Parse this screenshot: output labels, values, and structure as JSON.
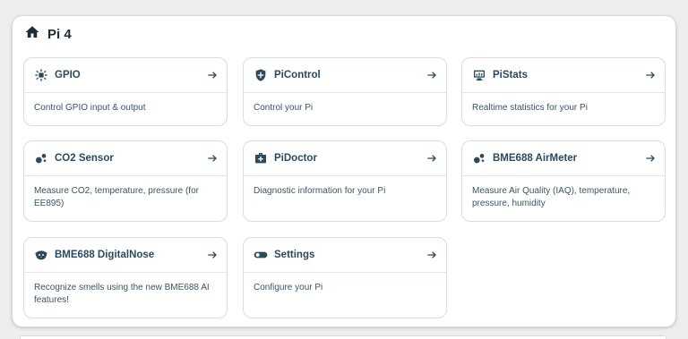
{
  "header": {
    "title": "Pi 4",
    "icon": "home-icon"
  },
  "cards": [
    {
      "title": "GPIO",
      "description": "Control GPIO input & output",
      "icon": "gpio-chip-icon"
    },
    {
      "title": "PiControl",
      "description": "Control your Pi",
      "icon": "shield-icon"
    },
    {
      "title": "PiStats",
      "description": "Realtime statistics for your Pi",
      "icon": "monitor-chart-icon"
    },
    {
      "title": "CO2 Sensor",
      "description": "Measure CO2, temperature, pressure (for EE895)",
      "icon": "bubbles-icon"
    },
    {
      "title": "PiDoctor",
      "description": "Diagnostic information for your Pi",
      "icon": "medical-bag-icon"
    },
    {
      "title": "BME688 AirMeter",
      "description": "Measure Air Quality (IAQ), temperature, pressure, humidity",
      "icon": "bubbles-icon"
    },
    {
      "title": "BME688 DigitalNose",
      "description": "Recognize smells using the new BME688 AI features!",
      "icon": "dog-nose-icon"
    },
    {
      "title": "Settings",
      "description": "Configure your Pi",
      "icon": "toggle-icon"
    }
  ],
  "colors": {
    "text": "#2b4a5e",
    "border": "#d7dde2",
    "background": "#eeeeee"
  }
}
